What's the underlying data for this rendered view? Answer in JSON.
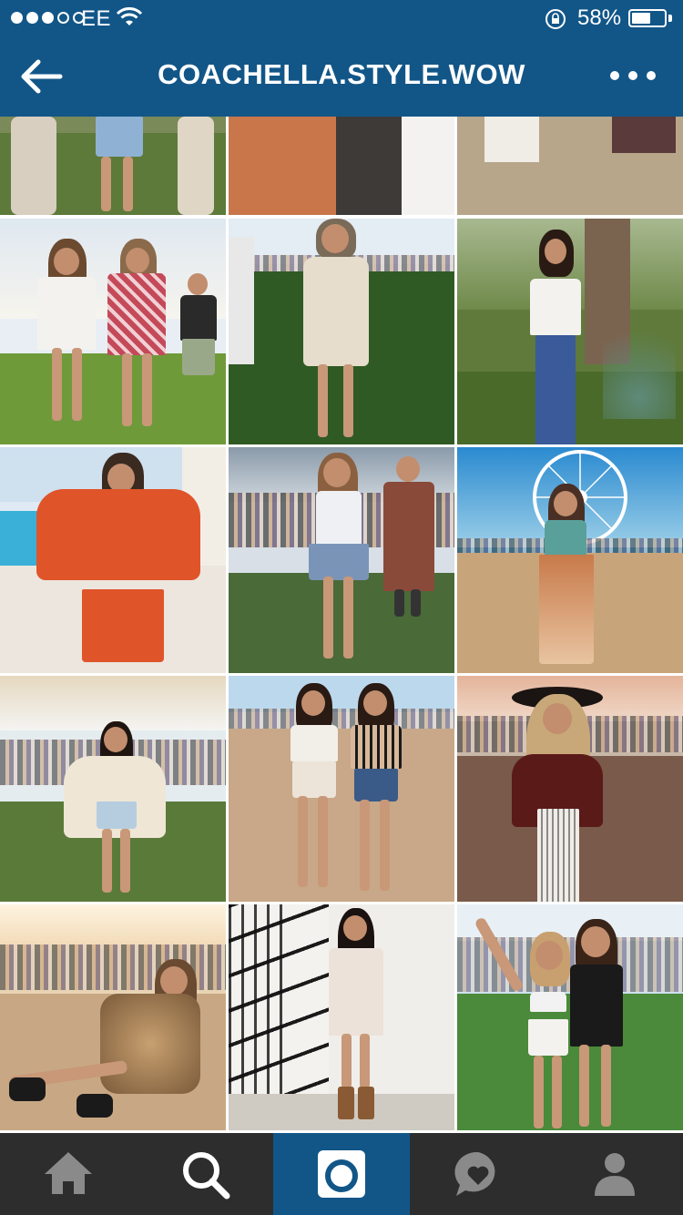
{
  "status_bar": {
    "signal": "●●●○○",
    "carrier": "EE",
    "wifi_icon": "wifi-icon",
    "rotation_lock_icon": "rotation-lock-icon",
    "battery_percent": "58%",
    "battery_level": 0.58
  },
  "header": {
    "back_icon": "back-arrow-icon",
    "title": "COACHELLA.STYLE.WOW",
    "more_icon": "more-options-icon"
  },
  "grid": {
    "columns": 3,
    "posts_visible": 15
  },
  "tabbar": {
    "tabs": [
      {
        "icon": "home-icon",
        "active": false
      },
      {
        "icon": "search-icon",
        "active": true
      },
      {
        "icon": "camera-icon",
        "active": false
      },
      {
        "icon": "activity-icon",
        "active": false
      },
      {
        "icon": "profile-icon",
        "active": false
      }
    ]
  },
  "colors": {
    "header_bg": "#125688",
    "tabbar_bg": "#2d2d2d",
    "active_tab_bg": "#125688",
    "icon_color": "#8a8a8a",
    "active_icon_color": "#ffffff"
  }
}
